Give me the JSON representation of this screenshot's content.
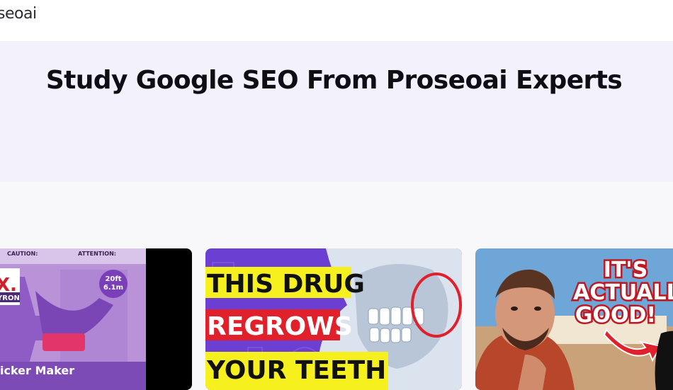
{
  "header": {
    "logo_text": "seoai"
  },
  "hero": {
    "title": "Study Google SEO From Proseoai Experts"
  },
  "cards": [
    {
      "caution": "CAUTION:",
      "attention": "ATTENTION:",
      "brand": "X.",
      "brand_sub": "YRON",
      "badge_line1": "20ft",
      "badge_line2": "6.1m",
      "product": "icker Maker"
    },
    {
      "line1": "THIS DRUG",
      "line2": "REGROWS",
      "line3": "YOUR TEETH"
    },
    {
      "line1": "IT'S",
      "line2": "ACTUALLY",
      "line3": "GOOD!"
    }
  ],
  "colors": {
    "hero_bg": "#f2f1fc",
    "page_bg": "#f8f8fb",
    "purple": "#8e5cc4",
    "yellow": "#f5f01e",
    "red": "#e0202a"
  }
}
